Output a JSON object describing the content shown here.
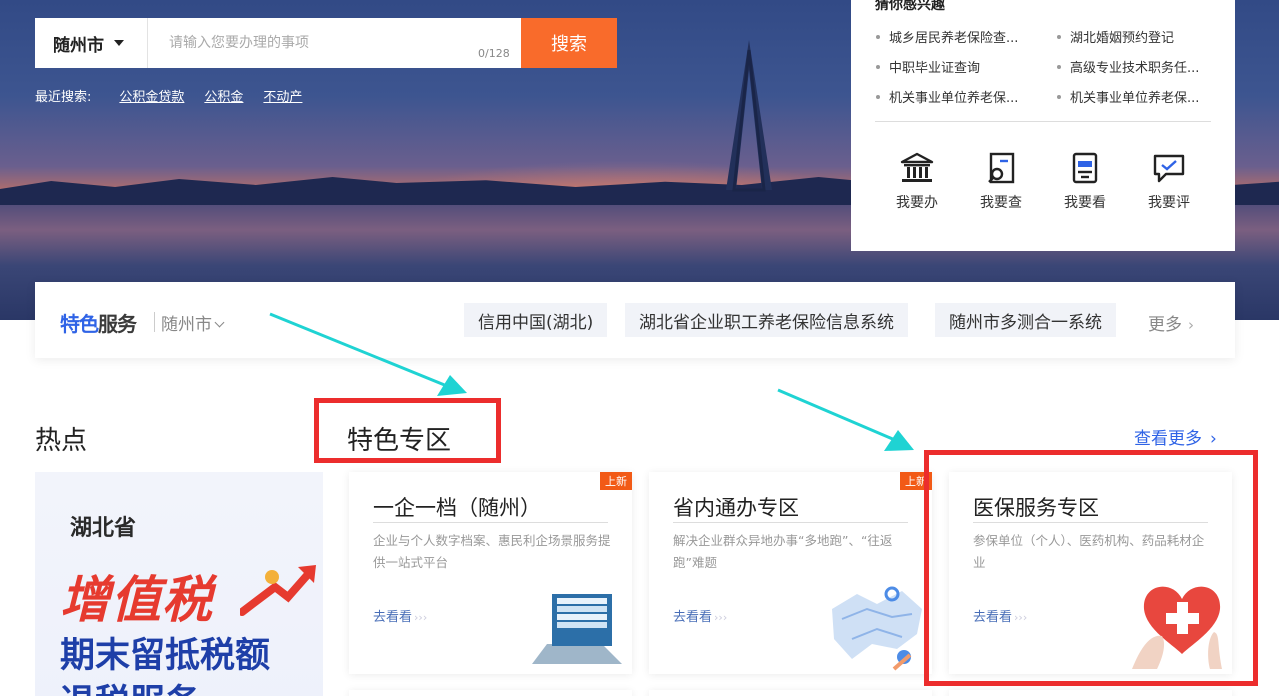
{
  "search": {
    "city": "随州市",
    "placeholder": "请输入您要办理的事项",
    "counter": "0/128",
    "button": "搜索"
  },
  "recent": {
    "label": "最近搜索:",
    "links": [
      "公积金贷款",
      "公积金",
      "不动产"
    ]
  },
  "interest": {
    "title": "猜你感兴趣",
    "items": [
      "城乡居民养老保险查...",
      "湖北婚姻预约登记",
      "中职毕业证查询",
      "高级专业技术职务任...",
      "机关事业单位养老保...",
      "机关事业单位养老保..."
    ],
    "actions": [
      {
        "label": "我要办",
        "icon": "bank-icon"
      },
      {
        "label": "我要查",
        "icon": "search-doc-icon"
      },
      {
        "label": "我要看",
        "icon": "view-doc-icon"
      },
      {
        "label": "我要评",
        "icon": "comment-check-icon"
      }
    ]
  },
  "services": {
    "brand_part1": "特色",
    "brand_part2": "服务",
    "city": "随州市",
    "tags": [
      "信用中国(湖北)",
      "湖北省企业职工养老保险信息系统",
      "随州市多测合一系统"
    ],
    "more": "更多"
  },
  "sections": {
    "hot": "热点",
    "zone": "特色专区",
    "see_more": "查看更多"
  },
  "banner": {
    "province": "湖北省",
    "headline": "增值税",
    "line2": "期末留抵税额",
    "line3": "退税服务"
  },
  "cards": [
    {
      "title": "一企一档（随州）",
      "desc": "企业与个人数字档案、惠民利企场景服务提供一站式平台",
      "go": "去看看",
      "badge": "上新"
    },
    {
      "title": "省内通办专区",
      "desc": "解决企业群众异地办事“多地跑”、“往返跑”难题",
      "go": "去看看",
      "badge": "上新"
    },
    {
      "title": "医保服务专区",
      "desc": "参保单位（个人）、医药机构、药品耗材企业",
      "go": "去看看",
      "badge": ""
    }
  ],
  "colors": {
    "accent_blue": "#2f63e6",
    "search_orange": "#f96b2b",
    "annotation_red": "#ec2d2d",
    "annotation_cyan": "#1fd3d3"
  }
}
